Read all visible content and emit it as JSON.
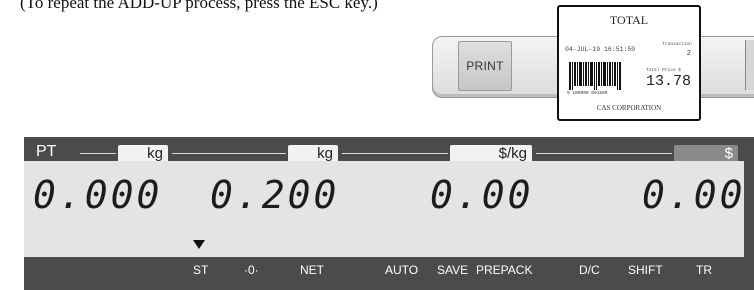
{
  "instruction": "(To repeat the ADD-UP process, press the ESC key.)",
  "printer": {
    "print_label": "PRINT"
  },
  "receipt": {
    "title": "TOTAL",
    "datetime": "04-JUL-19  16:51:50",
    "count_caption": "Transaction",
    "count": "2",
    "amount_caption": "Total Price $",
    "amount": "13.78",
    "barcode_number": "9 100000 001509",
    "company": "CAS CORPORATION"
  },
  "display": {
    "pt_label": "PT",
    "unit_labels": [
      "kg",
      "kg",
      "$/kg",
      "$"
    ],
    "readings": [
      "0.000",
      "0.200",
      "0.00",
      "0.00"
    ],
    "indicator_under": "ST",
    "status_labels": [
      "ST",
      "·0·",
      "NET",
      "AUTO",
      "SAVE",
      "PREPACK",
      "D/C",
      "SHIFT",
      "TR"
    ],
    "colors": {
      "panel": "#4b4b4b",
      "lcd": "#e4e4e4",
      "highlight_box": "#8a8a8a"
    }
  }
}
